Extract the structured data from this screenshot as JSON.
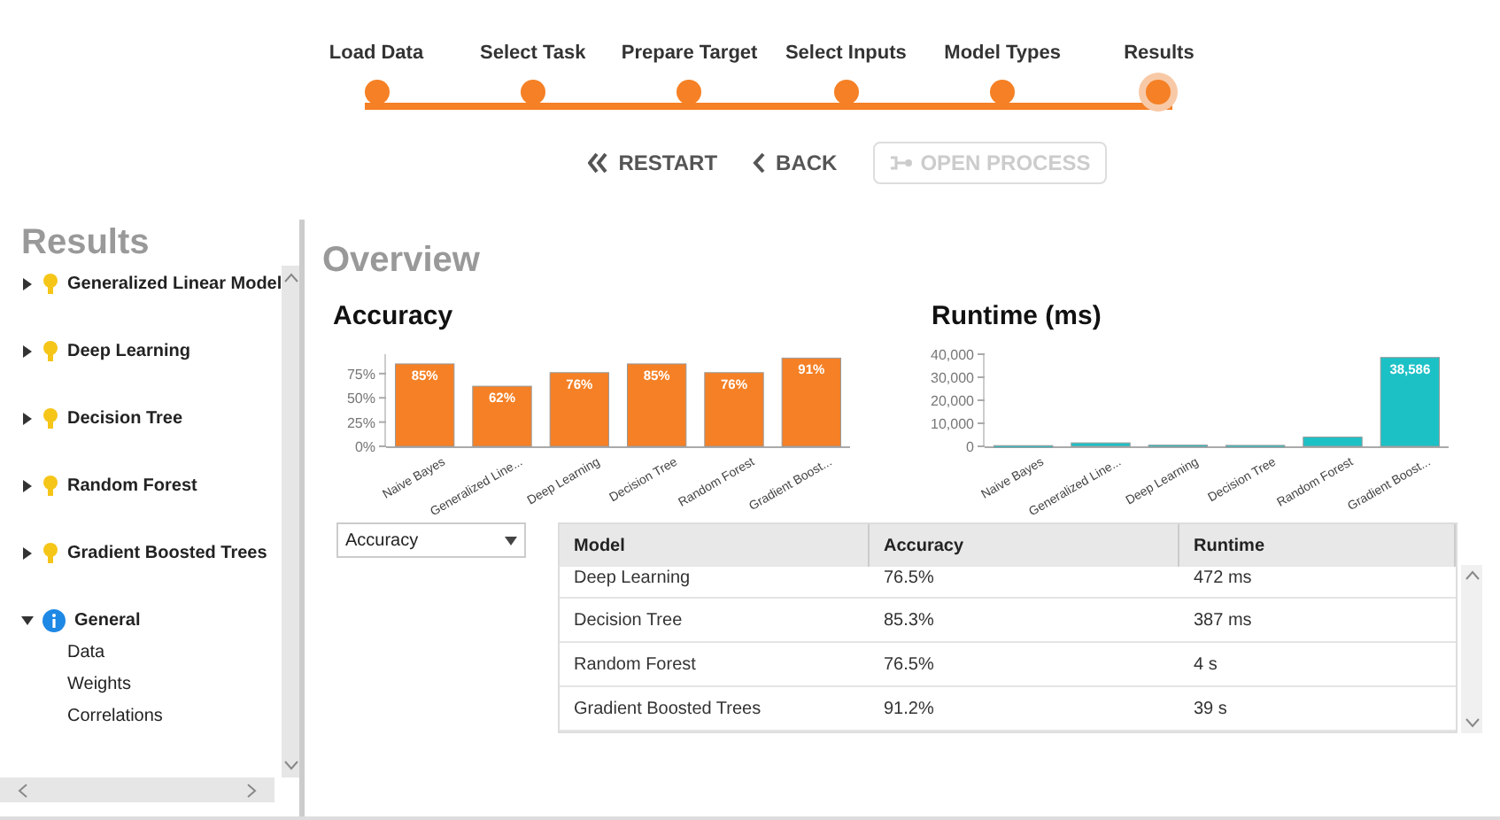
{
  "steps": [
    {
      "label": "Load Data",
      "selected": false
    },
    {
      "label": "Select Task",
      "selected": false
    },
    {
      "label": "Prepare Target",
      "selected": false
    },
    {
      "label": "Select Inputs",
      "selected": false
    },
    {
      "label": "Model Types",
      "selected": false
    },
    {
      "label": "Results",
      "selected": true
    }
  ],
  "actions": [
    {
      "kind": "restart",
      "label": "RESTART",
      "disabled": false
    },
    {
      "kind": "back",
      "label": "BACK",
      "disabled": false
    },
    {
      "kind": "open",
      "label": "OPEN PROCESS",
      "disabled": true
    }
  ],
  "sidebar": {
    "title": "Results",
    "items": [
      {
        "label": "Generalized Linear Model",
        "kind": "model",
        "expanded": false
      },
      {
        "label": "Deep Learning",
        "kind": "model",
        "expanded": false
      },
      {
        "label": "Decision Tree",
        "kind": "model",
        "expanded": false
      },
      {
        "label": "Random Forest",
        "kind": "model",
        "expanded": false
      },
      {
        "label": "Gradient Boosted Trees",
        "kind": "model",
        "expanded": false
      },
      {
        "label": "General",
        "kind": "info",
        "expanded": true,
        "children": [
          {
            "label": "Data"
          },
          {
            "label": "Weights"
          },
          {
            "label": "Correlations"
          }
        ]
      }
    ]
  },
  "main": {
    "title": "Overview",
    "charts": [
      {
        "title": "Accuracy",
        "chart_data": {
          "type": "bar",
          "categories": [
            "Naive Bayes",
            "Generalized Line...",
            "Deep Learning",
            "Decision Tree",
            "Random Forest",
            "Gradient Boost..."
          ],
          "series": [
            {
              "color": "#f58025",
              "values": [
                85,
                62,
                76,
                85,
                76,
                91
              ]
            }
          ],
          "ylim": [
            0,
            95
          ],
          "yticks": [
            {
              "value": 0,
              "label": "0%"
            },
            {
              "value": 25,
              "label": "25%"
            },
            {
              "value": 50,
              "label": "50%"
            },
            {
              "value": 75,
              "label": "75%"
            }
          ],
          "value_labels": [
            "85%",
            "62%",
            "76%",
            "85%",
            "76%",
            "91%"
          ]
        }
      },
      {
        "title": "Runtime (ms)",
        "chart_data": {
          "type": "bar",
          "categories": [
            "Naive Bayes",
            "Generalized Line...",
            "Deep Learning",
            "Decision Tree",
            "Random Forest",
            "Gradient Boost..."
          ],
          "series": [
            {
              "color": "#1cc1c6",
              "values": [
                300,
                1500,
                500,
                400,
                4000,
                38586
              ]
            }
          ],
          "ylim": [
            0,
            40000
          ],
          "yticks": [
            {
              "value": 0,
              "label": "0"
            },
            {
              "value": 10000,
              "label": "10,000"
            },
            {
              "value": 20000,
              "label": "20,000"
            },
            {
              "value": 30000,
              "label": "30,000"
            },
            {
              "value": 40000,
              "label": "40,000"
            }
          ],
          "value_labels": [
            null,
            null,
            null,
            null,
            null,
            "38,586"
          ]
        }
      }
    ],
    "metric_select": {
      "value": "Accuracy"
    },
    "table": {
      "columns": [
        "Model",
        "Accuracy",
        "Runtime"
      ],
      "rows": [
        [
          "Deep Learning",
          "76.5%",
          "472 ms"
        ],
        [
          "Decision Tree",
          "85.3%",
          "387 ms"
        ],
        [
          "Random Forest",
          "76.5%",
          "4 s"
        ],
        [
          "Gradient Boosted Trees",
          "91.2%",
          "39 s"
        ]
      ]
    }
  }
}
